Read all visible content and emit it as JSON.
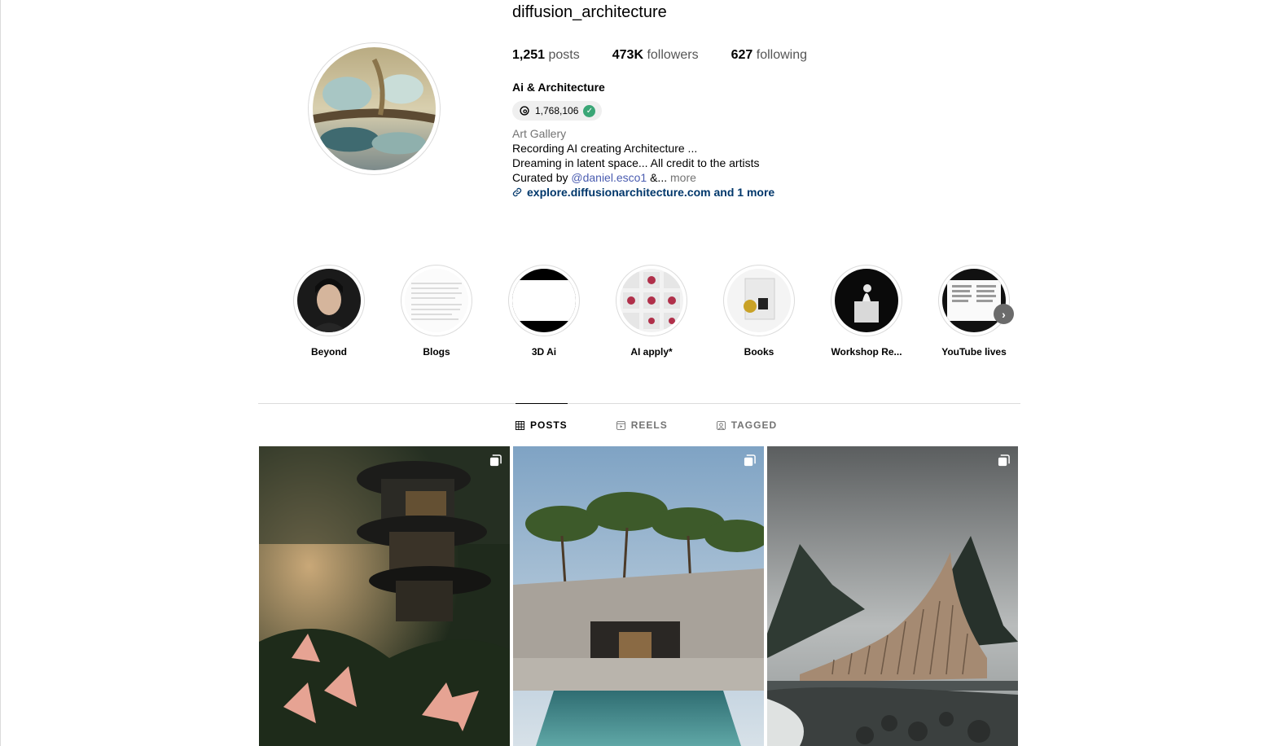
{
  "profile": {
    "username": "diffusion_architecture",
    "full_name": "Ai & Architecture",
    "threads_count": "1,768,106",
    "stats": {
      "posts_value": "1,251",
      "posts_label": "posts",
      "followers_value": "473K",
      "followers_label": "followers",
      "following_value": "627",
      "following_label": "following"
    },
    "bio": {
      "category": "Art Gallery",
      "line1": "Recording AI creating Architecture ...",
      "line2": "Dreaming in latent space... All credit to the artists",
      "curated_prefix": "Curated by ",
      "mention": "@daniel.esco1",
      "ellipsis": " &...",
      "more": " more",
      "link": "explore.diffusionarchitecture.com and 1 more"
    }
  },
  "highlights": [
    {
      "label": "Beyond"
    },
    {
      "label": "Blogs"
    },
    {
      "label": "3D Ai"
    },
    {
      "label": "AI apply*"
    },
    {
      "label": "Books"
    },
    {
      "label": "Workshop Re..."
    },
    {
      "label": "YouTube lives"
    }
  ],
  "tabs": [
    {
      "label": "POSTS",
      "icon": "grid-icon",
      "active": true
    },
    {
      "label": "REELS",
      "icon": "reels-icon",
      "active": false
    },
    {
      "label": "TAGGED",
      "icon": "tagged-icon",
      "active": false
    }
  ],
  "posts": [
    {
      "subject": "forest-treehouse",
      "icon": "carousel-icon"
    },
    {
      "subject": "stone-pool-house",
      "icon": "carousel-icon"
    },
    {
      "subject": "coastal-curved-building",
      "icon": "carousel-icon"
    }
  ],
  "colors": {
    "link": "#00376b",
    "mention": "#4a5cb0",
    "muted": "#737373",
    "verified": "#3aa676",
    "border": "#dbdbdb"
  }
}
